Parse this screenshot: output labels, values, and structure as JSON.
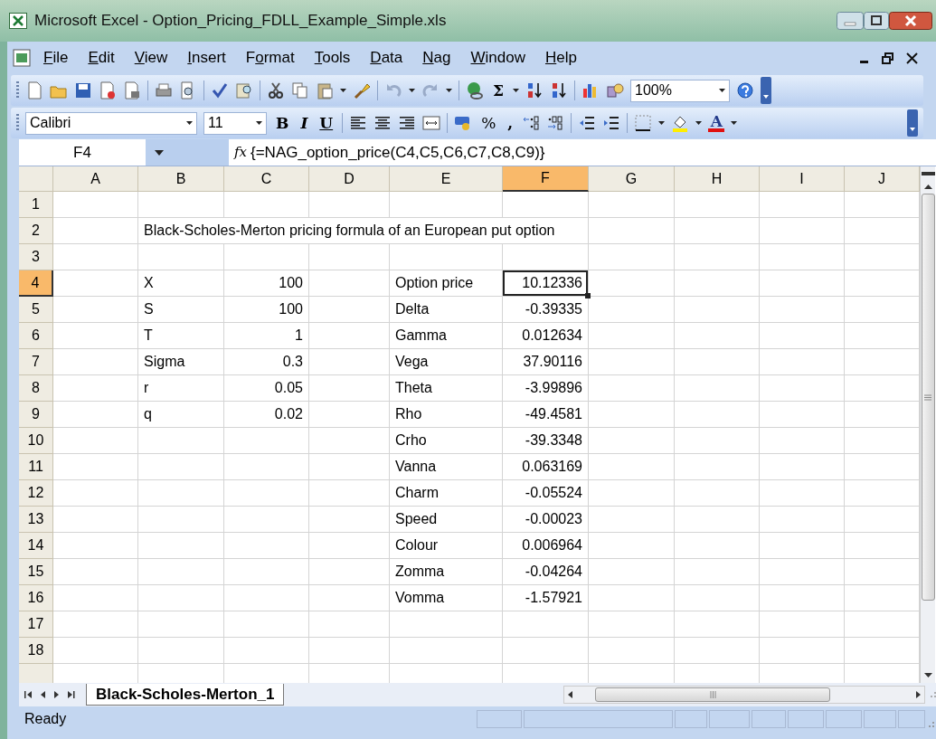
{
  "window": {
    "title": "Microsoft Excel - Option_Pricing_FDLL_Example_Simple.xls"
  },
  "menu": [
    {
      "key": "F",
      "after": "ile"
    },
    {
      "key": "E",
      "after": "dit"
    },
    {
      "key": "V",
      "after": "iew"
    },
    {
      "key": "I",
      "after": "nsert"
    },
    {
      "before": "F",
      "key": "o",
      "after": "rmat"
    },
    {
      "key": "T",
      "after": "ools"
    },
    {
      "key": "D",
      "after": "ata"
    },
    {
      "key": "N",
      "after": "ag"
    },
    {
      "key": "W",
      "after": "indow"
    },
    {
      "key": "H",
      "after": "elp"
    }
  ],
  "standard_toolbar": {
    "sum": "Σ",
    "zoom": "100%"
  },
  "formatting_toolbar": {
    "font": "Calibri",
    "size": "11",
    "bold": "B",
    "italic": "I",
    "underline": "U",
    "percent": "%",
    "comma": ",",
    "font_color": "A"
  },
  "formula_bar": {
    "name_box": "F4",
    "function_label": "fx",
    "formula": "{=NAG_option_price(C4,C5,C6,C7,C8,C9)}"
  },
  "sheet": {
    "columns": [
      {
        "label": "A",
        "selected": false
      },
      {
        "label": "B",
        "selected": false
      },
      {
        "label": "C",
        "selected": false
      },
      {
        "label": "D",
        "selected": false
      },
      {
        "label": "E",
        "selected": false
      },
      {
        "label": "F",
        "selected": true
      },
      {
        "label": "G",
        "selected": false
      },
      {
        "label": "H",
        "selected": false
      },
      {
        "label": "I",
        "selected": false
      },
      {
        "label": "J",
        "selected": false
      }
    ],
    "rows": [
      {
        "number": "1",
        "selected": false
      },
      {
        "number": "2",
        "selected": false,
        "cells": [
          null,
          {
            "text": "Black-Scholes-Merton pricing formula of an European put option",
            "kind": "text"
          }
        ]
      },
      {
        "number": "3",
        "selected": false
      },
      {
        "number": "4",
        "selected": true,
        "cells": [
          null,
          {
            "text": "X",
            "kind": "text"
          },
          {
            "text": "100",
            "kind": "number"
          },
          null,
          {
            "text": "Option price",
            "kind": "text"
          },
          {
            "text": "10.12336",
            "kind": "number"
          }
        ]
      },
      {
        "number": "5",
        "selected": false,
        "cells": [
          null,
          {
            "text": "S",
            "kind": "text"
          },
          {
            "text": "100",
            "kind": "number"
          },
          null,
          {
            "text": "Delta",
            "kind": "text"
          },
          {
            "text": "-0.39335",
            "kind": "number"
          }
        ]
      },
      {
        "number": "6",
        "selected": false,
        "cells": [
          null,
          {
            "text": "T",
            "kind": "text"
          },
          {
            "text": "1",
            "kind": "number"
          },
          null,
          {
            "text": "Gamma",
            "kind": "text"
          },
          {
            "text": "0.012634",
            "kind": "number"
          }
        ]
      },
      {
        "number": "7",
        "selected": false,
        "cells": [
          null,
          {
            "text": "Sigma",
            "kind": "text"
          },
          {
            "text": "0.3",
            "kind": "number"
          },
          null,
          {
            "text": "Vega",
            "kind": "text"
          },
          {
            "text": "37.90116",
            "kind": "number"
          }
        ]
      },
      {
        "number": "8",
        "selected": false,
        "cells": [
          null,
          {
            "text": "r",
            "kind": "text"
          },
          {
            "text": "0.05",
            "kind": "number"
          },
          null,
          {
            "text": "Theta",
            "kind": "text"
          },
          {
            "text": "-3.99896",
            "kind": "number"
          }
        ]
      },
      {
        "number": "9",
        "selected": false,
        "cells": [
          null,
          {
            "text": "q",
            "kind": "text"
          },
          {
            "text": "0.02",
            "kind": "number"
          },
          null,
          {
            "text": "Rho",
            "kind": "text"
          },
          {
            "text": "-49.4581",
            "kind": "number"
          }
        ]
      },
      {
        "number": "10",
        "selected": false,
        "cells": [
          null,
          null,
          null,
          null,
          {
            "text": "Crho",
            "kind": "text"
          },
          {
            "text": "-39.3348",
            "kind": "number"
          }
        ]
      },
      {
        "number": "11",
        "selected": false,
        "cells": [
          null,
          null,
          null,
          null,
          {
            "text": "Vanna",
            "kind": "text"
          },
          {
            "text": "0.063169",
            "kind": "number"
          }
        ]
      },
      {
        "number": "12",
        "selected": false,
        "cells": [
          null,
          null,
          null,
          null,
          {
            "text": "Charm",
            "kind": "text"
          },
          {
            "text": "-0.05524",
            "kind": "number"
          }
        ]
      },
      {
        "number": "13",
        "selected": false,
        "cells": [
          null,
          null,
          null,
          null,
          {
            "text": "Speed",
            "kind": "text"
          },
          {
            "text": "-0.00023",
            "kind": "number"
          }
        ]
      },
      {
        "number": "14",
        "selected": false,
        "cells": [
          null,
          null,
          null,
          null,
          {
            "text": "Colour",
            "kind": "text"
          },
          {
            "text": "0.006964",
            "kind": "number"
          }
        ]
      },
      {
        "number": "15",
        "selected": false,
        "cells": [
          null,
          null,
          null,
          null,
          {
            "text": "Zomma",
            "kind": "text"
          },
          {
            "text": "-0.04264",
            "kind": "number"
          }
        ]
      },
      {
        "number": "16",
        "selected": false,
        "cells": [
          null,
          null,
          null,
          null,
          {
            "text": "Vomma",
            "kind": "text"
          },
          {
            "text": "-1.57921",
            "kind": "number"
          }
        ]
      },
      {
        "number": "17",
        "selected": false
      },
      {
        "number": "18",
        "selected": false
      }
    ]
  },
  "sheet_tabs": [
    {
      "label": "Black-Scholes-Merton_1",
      "selected": true
    }
  ],
  "status_bar": {
    "text": "Ready"
  }
}
